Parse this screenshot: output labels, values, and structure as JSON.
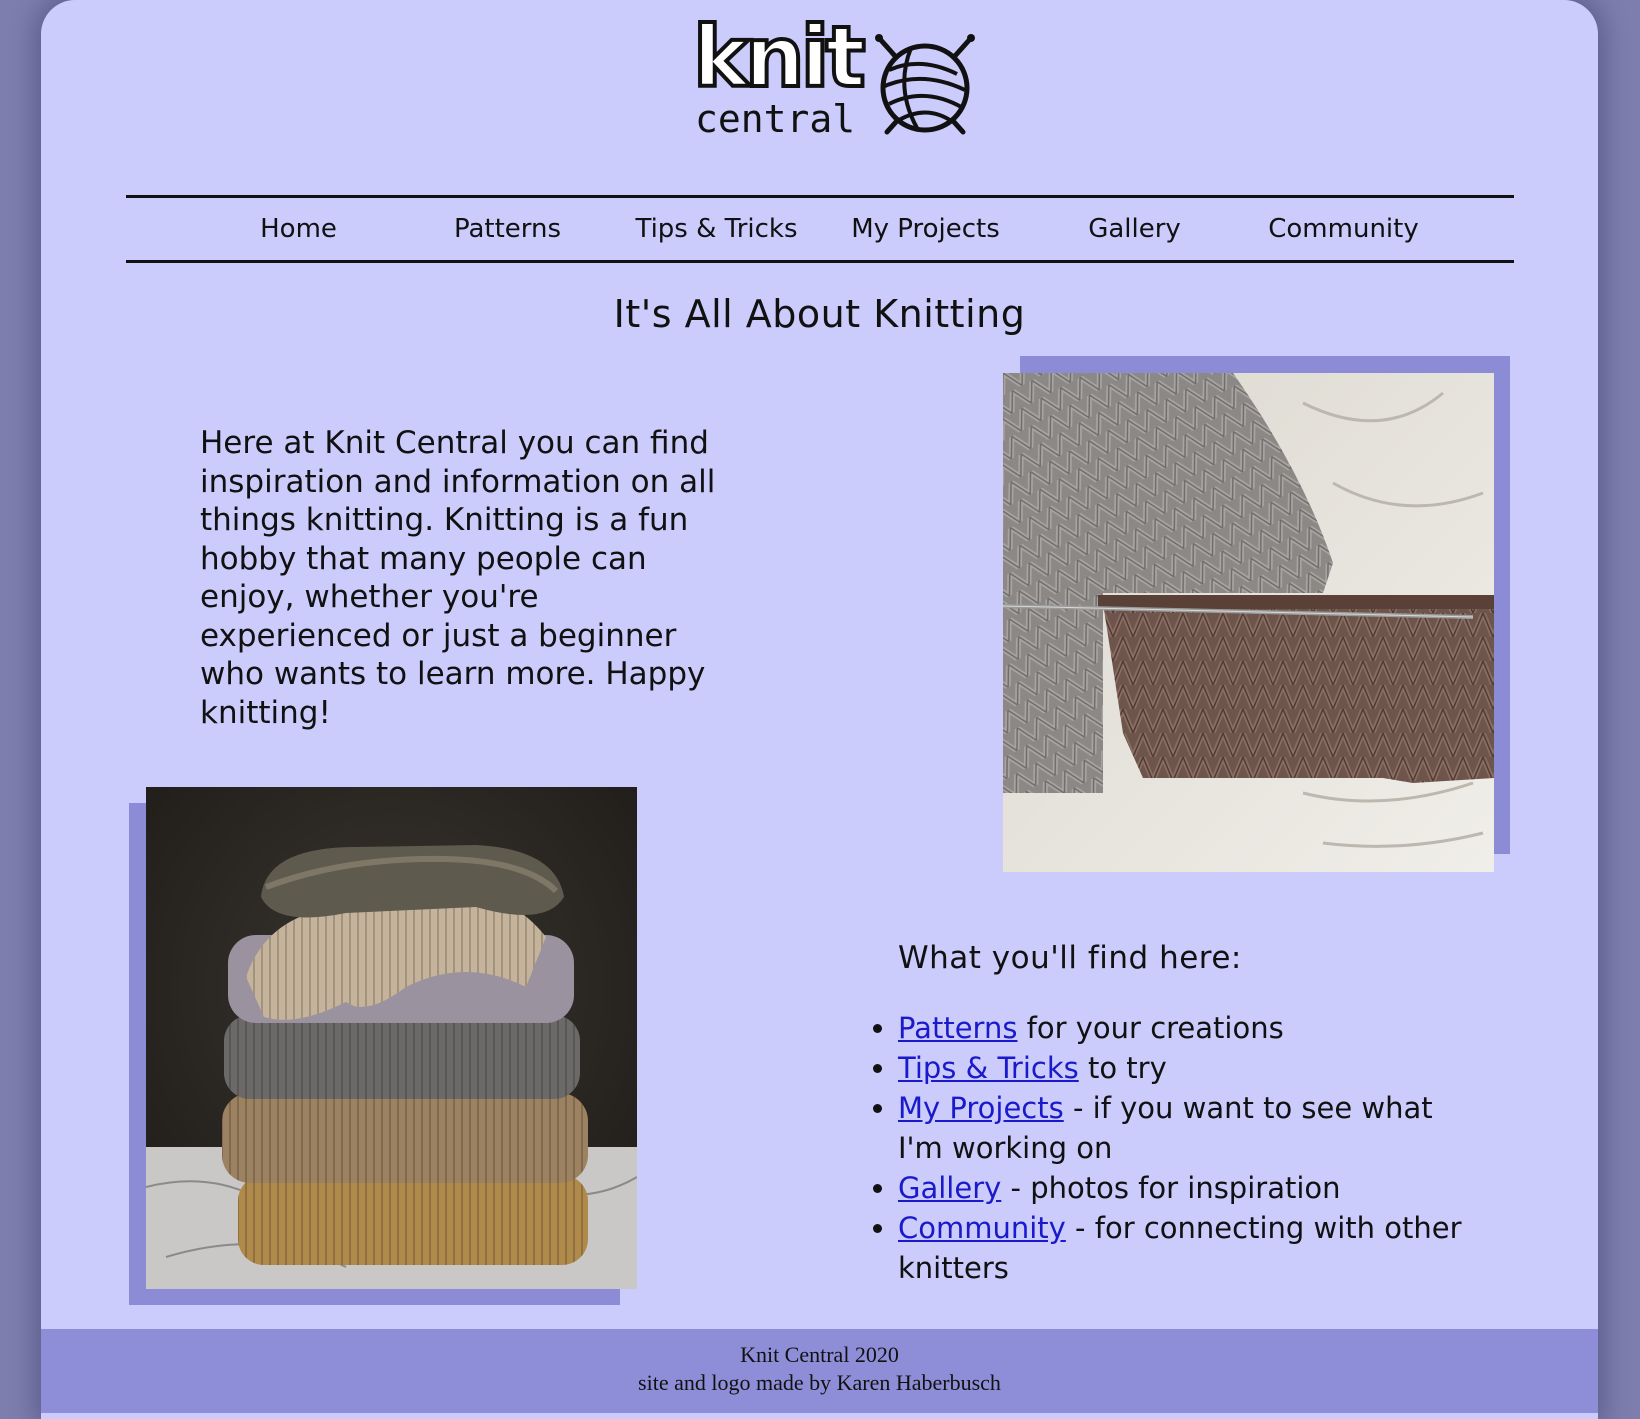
{
  "logo": {
    "word1": "knit",
    "word2": "central"
  },
  "nav": {
    "items": [
      {
        "label": "Home"
      },
      {
        "label": "Patterns"
      },
      {
        "label": "Tips & Tricks"
      },
      {
        "label": "My Projects"
      },
      {
        "label": "Gallery"
      },
      {
        "label": "Community"
      }
    ]
  },
  "main": {
    "title": "It's All About Knitting",
    "intro": "Here at Knit Central you can find inspiration and information on all things knitting. Knitting is a fun hobby that many people can enjoy, whether you're experienced or just a beginner who wants to learn more. Happy knitting!",
    "find": {
      "heading": "What you'll find here:",
      "items": [
        {
          "link": "Patterns",
          "text": " for your creations"
        },
        {
          "link": "Tips & Tricks",
          "text": " to try"
        },
        {
          "link": "My Projects",
          "text": " - if you want to see what I'm working on"
        },
        {
          "link": "Gallery",
          "text": " - photos for inspiration"
        },
        {
          "link": "Community",
          "text": " - for connecting with other knitters"
        }
      ]
    }
  },
  "footer": {
    "line1": "Knit Central 2020",
    "line2": "site and logo made by Karen Haberbusch"
  },
  "colors": {
    "page_bg": "#cbcbfc",
    "outer_bg": "#7e7eae",
    "accent": "#8e8ed8",
    "link": "#1a1acb"
  }
}
